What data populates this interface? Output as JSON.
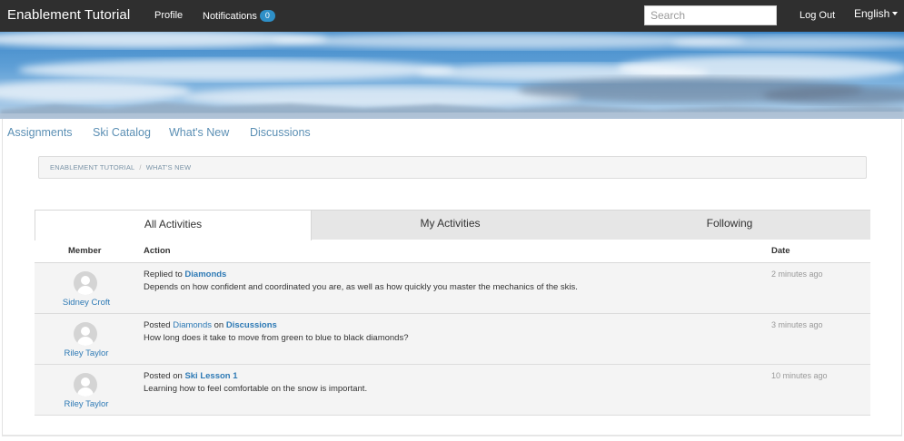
{
  "app": {
    "title": "Enablement Tutorial"
  },
  "navbar": {
    "profile": "Profile",
    "notifications": "Notifications",
    "notifications_count": "0",
    "search_placeholder": "Search",
    "logout": "Log Out",
    "language": "English"
  },
  "subnav": {
    "items": [
      {
        "label": "Assignments"
      },
      {
        "label": "Ski Catalog"
      },
      {
        "label": "What's New"
      },
      {
        "label": "Discussions"
      }
    ]
  },
  "breadcrumb": {
    "root": "ENABLEMENT TUTORIAL",
    "current": "WHAT'S NEW"
  },
  "activity_tabs": [
    {
      "label": "All Activities"
    },
    {
      "label": "My Activities"
    },
    {
      "label": "Following"
    }
  ],
  "table": {
    "headers": {
      "member": "Member",
      "action": "Action",
      "date": "Date"
    },
    "rows": [
      {
        "member": "Sidney Croft",
        "verb": "Replied to",
        "link1": "Diamonds",
        "connector": "",
        "link2": "",
        "detail": "Depends on how confident and coordinated you are, as well as how quickly you master the mechanics of the skis.",
        "date": "2 minutes ago"
      },
      {
        "member": "Riley Taylor",
        "verb": "Posted",
        "link1": "Diamonds",
        "connector": "on",
        "link2": "Discussions",
        "detail": "How long does it take to move from green to blue to black diamonds?",
        "date": "3 minutes ago"
      },
      {
        "member": "Riley Taylor",
        "verb": "Posted on",
        "link1": "Ski Lesson 1",
        "connector": "",
        "link2": "",
        "detail": "Learning how to feel comfortable on the snow is important.",
        "date": "10 minutes ago"
      }
    ]
  },
  "colors": {
    "navbar": "#2f2f2f",
    "link": "#2e7ab5",
    "badge": "#2e8fc7",
    "tab_inactive": "#e6e6e6"
  }
}
